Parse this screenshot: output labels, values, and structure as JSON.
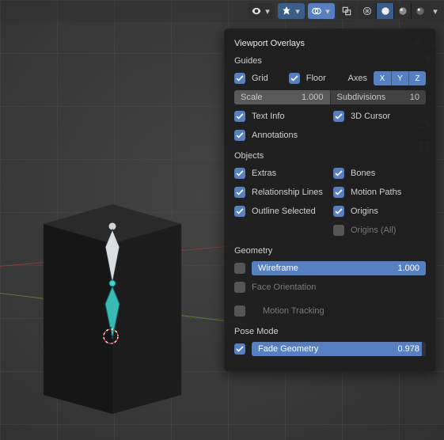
{
  "popover": {
    "title": "Viewport Overlays",
    "sections": {
      "guides": "Guides",
      "objects": "Objects",
      "geometry": "Geometry",
      "pose": "Pose Mode"
    },
    "grid_label": "Grid",
    "floor_label": "Floor",
    "axes_label": "Axes",
    "ax_x": "X",
    "ax_y": "Y",
    "ax_z": "Z",
    "scale_label": "Scale",
    "scale_value": "1.000",
    "subdiv_label": "Subdivisions",
    "subdiv_value": "10",
    "textinfo_label": "Text Info",
    "cursor3d_label": "3D Cursor",
    "annotations_label": "Annotations",
    "extras_label": "Extras",
    "bones_label": "Bones",
    "rel_label": "Relationship Lines",
    "motionpaths_label": "Motion Paths",
    "outlinesel_label": "Outline Selected",
    "origins_label": "Origins",
    "originsall_label": "Origins (All)",
    "wire_label": "Wireframe",
    "wire_value": "1.000",
    "faceori_label": "Face Orientation",
    "motiontrack_label": "Motion Tracking",
    "fadegeo_label": "Fade Geometry",
    "fadegeo_value": "0.978"
  },
  "header": {
    "visibility": "object-visibility",
    "gizmo": "gizmo-options",
    "overlays": "viewport-overlays",
    "xray": "toggle-xray",
    "shading": {
      "wire": "wireframe-shading",
      "solid": "solid-shading",
      "matprev": "material-preview",
      "rendered": "rendered-shading"
    }
  }
}
